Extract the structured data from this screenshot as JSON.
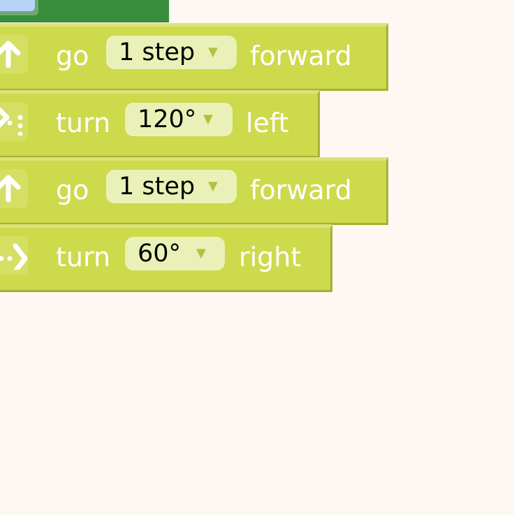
{
  "blocks": [
    {
      "verb": "go",
      "value": "1 step",
      "direction": "forward",
      "icon": "arrow-up-icon"
    },
    {
      "verb": "turn",
      "value": "120°",
      "direction": "left",
      "icon": "turn-left-icon"
    },
    {
      "verb": "go",
      "value": "1 step",
      "direction": "forward",
      "icon": "arrow-up-icon"
    },
    {
      "verb": "turn",
      "value": "60°",
      "direction": "right",
      "icon": "turn-right-icon"
    }
  ],
  "dropdown_glyph": "▼",
  "colors": {
    "background": "#fef8f3",
    "block": "#cdda4b",
    "block_shadow": "#a5b036",
    "field": "#eaf1b8",
    "hat_block": "#388e3c"
  }
}
